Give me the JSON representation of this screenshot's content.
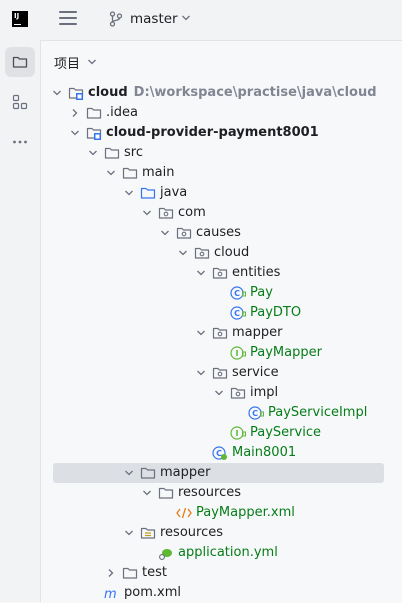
{
  "titlebar": {
    "logo": "IJ",
    "branch": "master"
  },
  "panel": {
    "title": "项目"
  },
  "tree": [
    {
      "label": "cloud",
      "path": "D:\\workspace\\practise\\java\\cloud",
      "depth": 0,
      "chevron": "down",
      "icon": "module",
      "bold": true
    },
    {
      "label": ".idea",
      "depth": 1,
      "chevron": "right",
      "icon": "folder"
    },
    {
      "label": "cloud-provider-payment8001",
      "depth": 1,
      "chevron": "down",
      "icon": "module",
      "bold": true
    },
    {
      "label": "src",
      "depth": 2,
      "chevron": "down",
      "icon": "folder"
    },
    {
      "label": "main",
      "depth": 3,
      "chevron": "down",
      "icon": "folder"
    },
    {
      "label": "java",
      "depth": 4,
      "chevron": "down",
      "icon": "source-folder"
    },
    {
      "label": "com",
      "depth": 5,
      "chevron": "down",
      "icon": "package"
    },
    {
      "label": "causes",
      "depth": 6,
      "chevron": "down",
      "icon": "package"
    },
    {
      "label": "cloud",
      "depth": 7,
      "chevron": "down",
      "icon": "package"
    },
    {
      "label": "entities",
      "depth": 8,
      "chevron": "down",
      "icon": "package"
    },
    {
      "label": "Pay",
      "depth": 9,
      "icon": "class",
      "green": true
    },
    {
      "label": "PayDTO",
      "depth": 9,
      "icon": "class",
      "green": true
    },
    {
      "label": "mapper",
      "depth": 8,
      "chevron": "down",
      "icon": "package"
    },
    {
      "label": "PayMapper",
      "depth": 9,
      "icon": "interface",
      "green": true
    },
    {
      "label": "service",
      "depth": 8,
      "chevron": "down",
      "icon": "package"
    },
    {
      "label": "impl",
      "depth": 9,
      "chevron": "down",
      "icon": "package"
    },
    {
      "label": "PayServiceImpl",
      "depth": 10,
      "icon": "class",
      "green": true
    },
    {
      "label": "PayService",
      "depth": 9,
      "icon": "interface",
      "green": true
    },
    {
      "label": "Main8001",
      "depth": 8,
      "icon": "spring-class",
      "green": true
    },
    {
      "label": "mapper",
      "depth": 4,
      "chevron": "down",
      "icon": "folder",
      "selected": true
    },
    {
      "label": "resources",
      "depth": 5,
      "chevron": "down",
      "icon": "folder"
    },
    {
      "label": "PayMapper.xml",
      "depth": 6,
      "icon": "xml",
      "green": true
    },
    {
      "label": "resources",
      "depth": 4,
      "chevron": "down",
      "icon": "resources-folder"
    },
    {
      "label": "application.yml",
      "depth": 5,
      "icon": "yaml",
      "green": true
    },
    {
      "label": "test",
      "depth": 3,
      "chevron": "right",
      "icon": "folder"
    },
    {
      "label": "pom.xml",
      "depth": 2,
      "icon": "maven"
    }
  ]
}
